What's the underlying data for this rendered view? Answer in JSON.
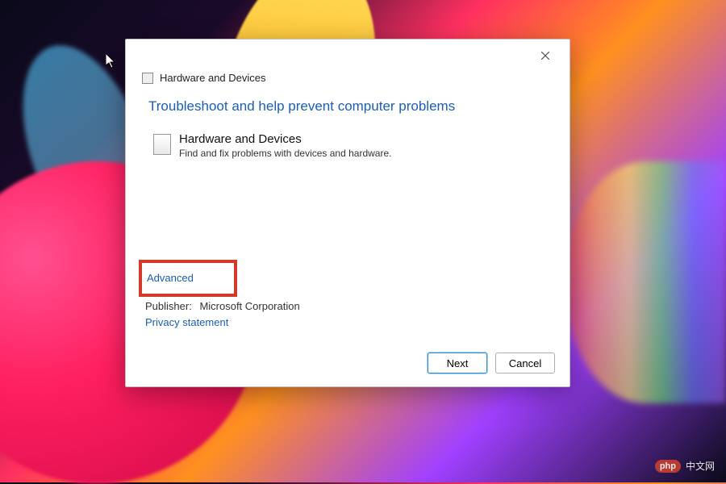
{
  "dialog": {
    "header_title": "Hardware and Devices",
    "heading": "Troubleshoot and help prevent computer problems",
    "section": {
      "title": "Hardware and Devices",
      "description": "Find and fix problems with devices and hardware."
    },
    "advanced_link": "Advanced",
    "publisher_label": "Publisher:",
    "publisher_value": "Microsoft Corporation",
    "privacy_link": "Privacy statement",
    "buttons": {
      "next": "Next",
      "cancel": "Cancel"
    }
  },
  "watermark": {
    "badge": "php",
    "text": "中文网"
  }
}
